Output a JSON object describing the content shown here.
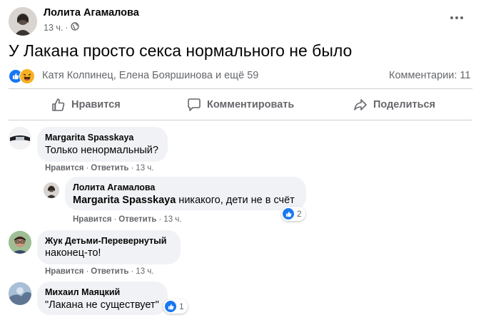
{
  "post": {
    "author": "Лолита Агамалова",
    "time": "13 ч.",
    "text": "У Лакана просто секса нормального не было",
    "reactors": "Катя Колпинец, Елена Бояршинова и ещё 59",
    "comments_count": "Комментарии: 11",
    "more_label": "..."
  },
  "actions": {
    "like": "Нравится",
    "comment": "Комментировать",
    "share": "Поделиться"
  },
  "comments": [
    {
      "author": "Margarita Spasskaya",
      "text": "Только ненормальный?",
      "like": "Нравится",
      "reply": "Ответить",
      "time": "13 ч."
    },
    {
      "author": "Лолита Агамалова",
      "mention": "Margarita Spasskaya",
      "text": " никакого, дети не в счёт",
      "like": "Нравится",
      "reply": "Ответить",
      "time": "13 ч.",
      "reactions": "2"
    },
    {
      "author": "Жук Детьми-Перевернутый",
      "text": "наконец-то!",
      "like": "Нравится",
      "reply": "Ответить",
      "time": "13 ч."
    },
    {
      "author": "Михаил Маяцкий",
      "text": "\"Лакана не существует\"",
      "reactions": "1"
    }
  ],
  "colors": {
    "accent": "#1877f2",
    "bubble": "#f0f2f5",
    "secondary_text": "#65676b",
    "haha": "#f7b125"
  }
}
